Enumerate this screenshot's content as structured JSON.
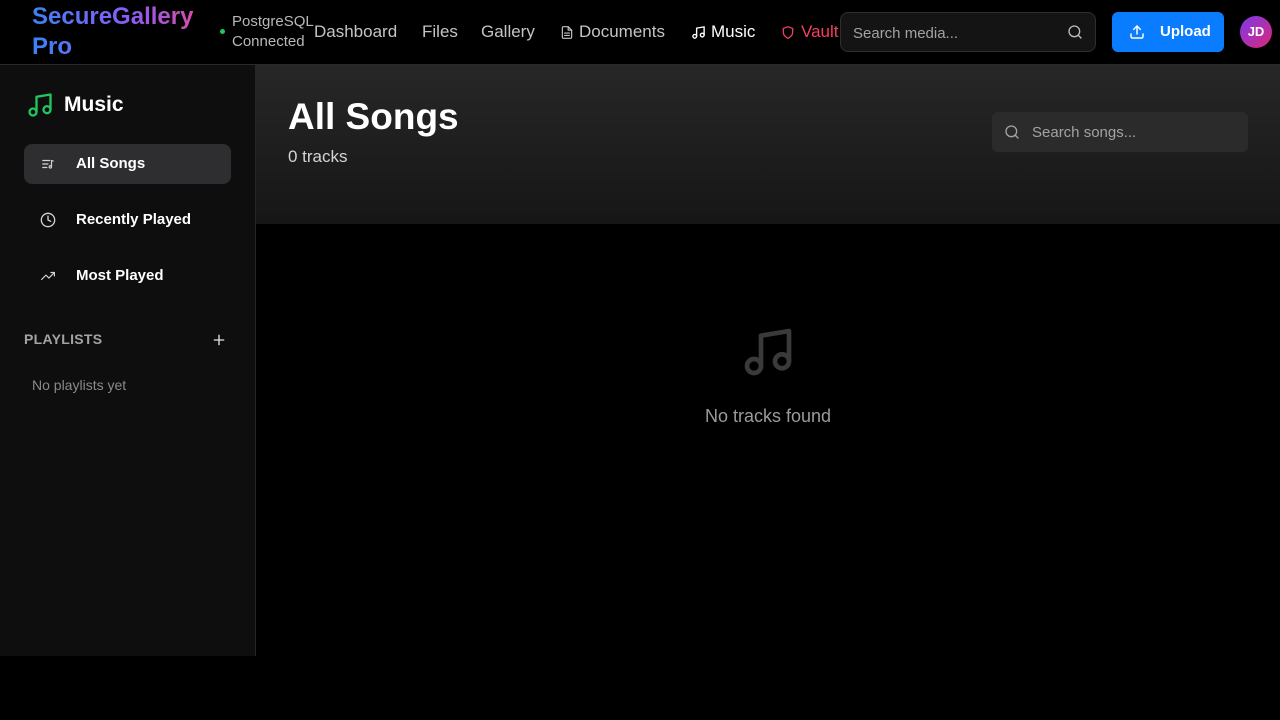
{
  "header": {
    "brand": "SecureGallery Pro",
    "db_status": "PostgreSQL Connected",
    "nav": {
      "dashboard": "Dashboard",
      "files": "Files",
      "gallery": "Gallery",
      "documents": "Documents",
      "music": "Music",
      "vault": "Vault"
    },
    "active_nav": "Music",
    "search_placeholder": "Search media...",
    "upload_label": "Upload",
    "avatar_initials": "JD",
    "colors": {
      "accent": "#0a7cff",
      "vault": "#f43f5e",
      "status_ok": "#22c55e"
    }
  },
  "sidebar": {
    "title": "Music",
    "items": [
      {
        "label": "All Songs",
        "icon": "list-music-icon",
        "active": true
      },
      {
        "label": "Recently Played",
        "icon": "clock-icon",
        "active": false
      },
      {
        "label": "Most Played",
        "icon": "trending-up-icon",
        "active": false
      }
    ],
    "playlists_heading": "PLAYLISTS",
    "playlists_empty": "No playlists yet",
    "accent": "#22c55e"
  },
  "main": {
    "title": "All Songs",
    "track_count": "0 tracks",
    "search_placeholder": "Search songs...",
    "empty_message": "No tracks found"
  }
}
